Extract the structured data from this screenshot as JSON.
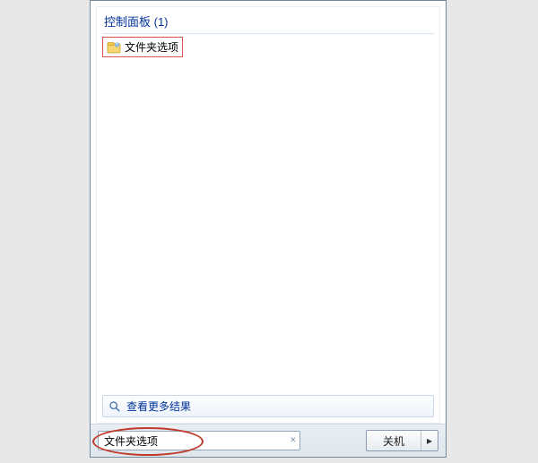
{
  "category_header": "控制面板 (1)",
  "result": {
    "icon": "folder-options-icon",
    "label": "文件夹选项"
  },
  "see_more": {
    "icon": "search-icon",
    "label": "查看更多结果"
  },
  "search": {
    "value": "文件夹选项",
    "clear_icon": "×"
  },
  "shutdown": {
    "label": "关机",
    "arrow": "▸"
  }
}
